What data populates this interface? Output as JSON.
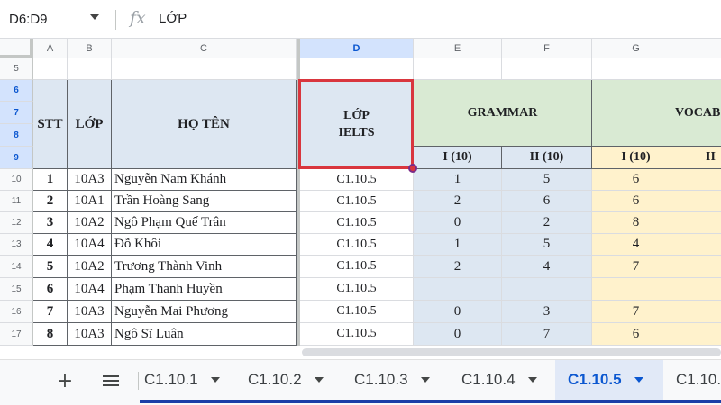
{
  "formula_bar": {
    "name_box": "D6:D9",
    "fx": "fx",
    "content": "LỚP"
  },
  "columns": [
    "A",
    "B",
    "C",
    "D",
    "E",
    "F",
    "G"
  ],
  "row_numbers": [
    "5",
    "6",
    "7",
    "8",
    "9",
    "10",
    "11",
    "12",
    "13",
    "14",
    "15",
    "16",
    "17"
  ],
  "headers": {
    "stt": "STT",
    "lop": "LỚP",
    "ho_ten": "HỌ TÊN",
    "lop_ielts_1": "LỚP",
    "lop_ielts_2": "IELTS",
    "grammar": "GRAMMAR",
    "vocab": "VOCAB",
    "g1": "I (10)",
    "g2": "II (10)",
    "v1": "I (10)",
    "v2": "II"
  },
  "rows": [
    {
      "stt": "1",
      "lop": "10A3",
      "name": "Nguyễn Nam Khánh",
      "ielts": "C1.10.5",
      "g1": "1",
      "g2": "5",
      "v1": "6"
    },
    {
      "stt": "2",
      "lop": "10A1",
      "name": "Trần Hoàng Sang",
      "ielts": "C1.10.5",
      "g1": "2",
      "g2": "6",
      "v1": "6"
    },
    {
      "stt": "3",
      "lop": "10A2",
      "name": "Ngô Phạm Quế Trân",
      "ielts": "C1.10.5",
      "g1": "0",
      "g2": "2",
      "v1": "8"
    },
    {
      "stt": "4",
      "lop": "10A4",
      "name": "Đỗ Khôi",
      "ielts": "C1.10.5",
      "g1": "1",
      "g2": "5",
      "v1": "4"
    },
    {
      "stt": "5",
      "lop": "10A2",
      "name": "Trương Thành Vinh",
      "ielts": "C1.10.5",
      "g1": "2",
      "g2": "4",
      "v1": "7"
    },
    {
      "stt": "6",
      "lop": "10A4",
      "name": "Phạm Thanh Huyền",
      "ielts": "C1.10.5",
      "g1": "",
      "g2": "",
      "v1": ""
    },
    {
      "stt": "7",
      "lop": "10A3",
      "name": "Nguyễn Mai Phương",
      "ielts": "C1.10.5",
      "g1": "0",
      "g2": "3",
      "v1": "7"
    },
    {
      "stt": "8",
      "lop": "10A3",
      "name": "Ngô Sĩ Luân",
      "ielts": "C1.10.5",
      "g1": "0",
      "g2": "7",
      "v1": "6"
    }
  ],
  "sheet_tabs": {
    "add": "+",
    "tabs": [
      {
        "label": "C1.10.1"
      },
      {
        "label": "C1.10.2"
      },
      {
        "label": "C1.10.3"
      },
      {
        "label": "C1.10.4"
      },
      {
        "label": "C1.10.5"
      },
      {
        "label": "C1.10."
      }
    ],
    "active_index": 4
  },
  "colors": {
    "selection": "#d9363e",
    "accent": "#0b57d0",
    "grammar_bg": "#d9ead3",
    "vocab_bg": "#fff2cc",
    "blue_bg": "#dde7f2"
  }
}
